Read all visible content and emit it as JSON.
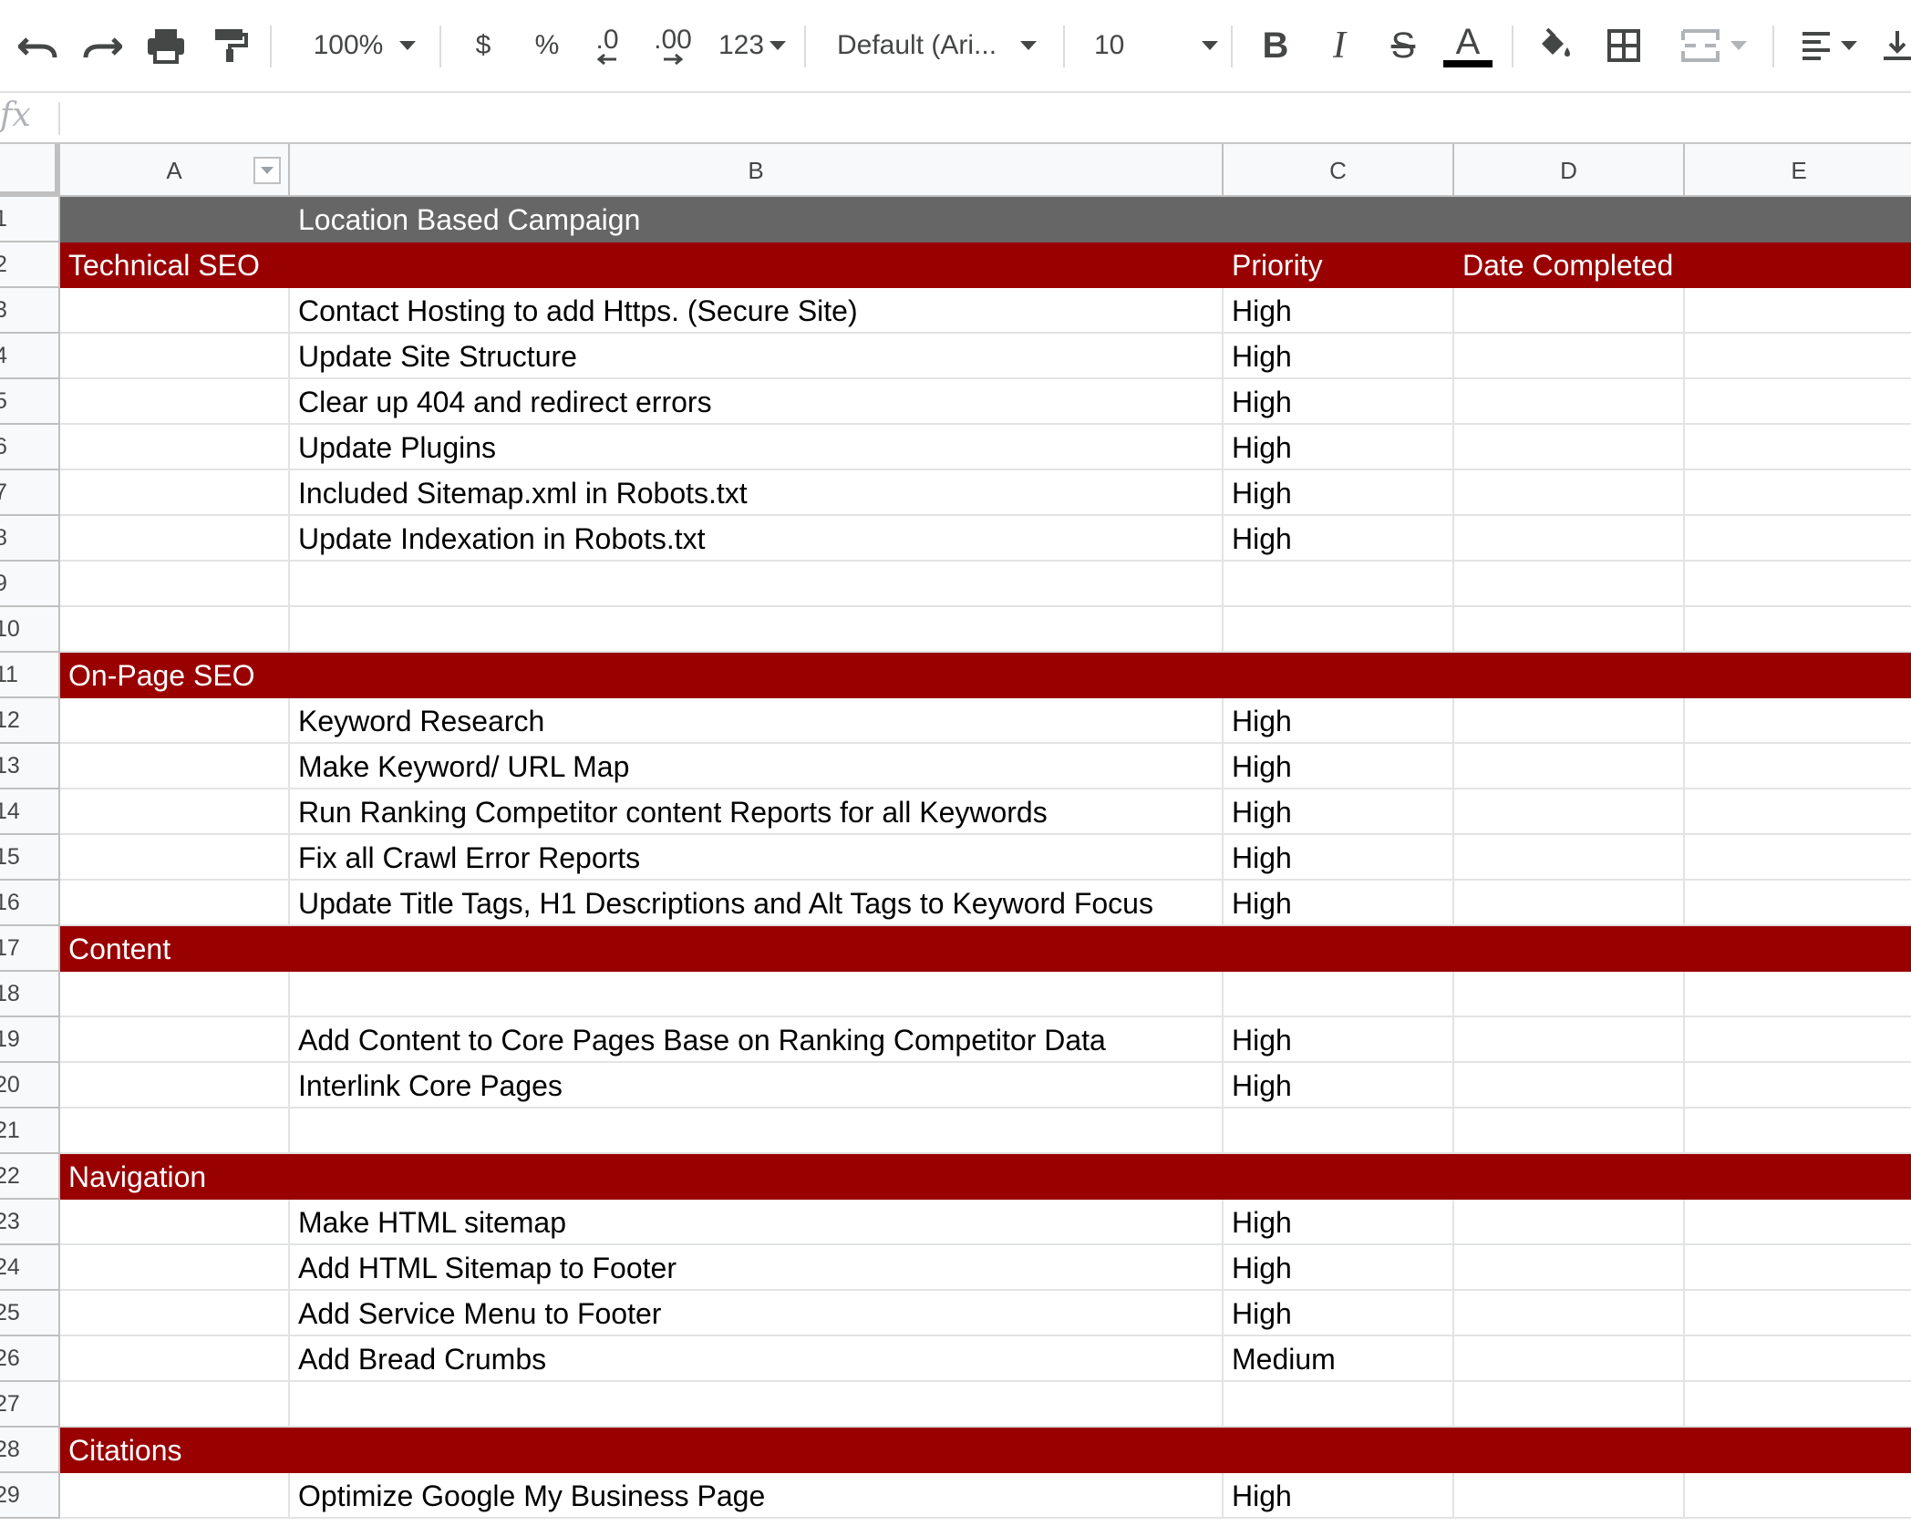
{
  "toolbar": {
    "zoom": "100%",
    "currency": "$",
    "percent": "%",
    "decrease_decimal": ".0",
    "increase_decimal": ".00",
    "more_formats": "123",
    "font": "Default (Ari...",
    "font_size": "10",
    "text_color_accent": "#000000"
  },
  "formula_bar": {
    "fx_label": "fx",
    "value": ""
  },
  "columns": [
    "A",
    "B",
    "C",
    "D",
    "E"
  ],
  "colors": {
    "title_bg": "#666666",
    "section_bg": "#990000",
    "section_text": "#ffffff"
  },
  "rows": [
    {
      "num": "1",
      "type": "title",
      "a": "",
      "b": "Location Based Campaign",
      "c": "",
      "d": ""
    },
    {
      "num": "2",
      "type": "section",
      "a": "Technical SEO",
      "b": "",
      "c": "Priority",
      "d": "Date Completed"
    },
    {
      "num": "3",
      "type": "data",
      "a": "",
      "b": "Contact Hosting to add Https.  (Secure Site)",
      "c": "High",
      "d": ""
    },
    {
      "num": "4",
      "type": "data",
      "a": "",
      "b": "Update Site Structure",
      "c": "High",
      "d": ""
    },
    {
      "num": "5",
      "type": "data",
      "a": "",
      "b": "Clear up 404 and redirect errors",
      "c": "High",
      "d": ""
    },
    {
      "num": "6",
      "type": "data",
      "a": "",
      "b": "Update Plugins",
      "c": "High",
      "d": ""
    },
    {
      "num": "7",
      "type": "data",
      "a": "",
      "b": "Included Sitemap.xml  in Robots.txt",
      "c": "High",
      "d": ""
    },
    {
      "num": "8",
      "type": "data",
      "a": "",
      "b": "Update Indexation in Robots.txt",
      "c": "High",
      "d": ""
    },
    {
      "num": "9",
      "type": "data",
      "a": "",
      "b": "",
      "c": "",
      "d": ""
    },
    {
      "num": "10",
      "type": "data",
      "a": "",
      "b": "",
      "c": "",
      "d": ""
    },
    {
      "num": "11",
      "type": "section",
      "a": "On-Page SEO",
      "b": "",
      "c": "",
      "d": ""
    },
    {
      "num": "12",
      "type": "data",
      "a": "",
      "b": "Keyword Research",
      "c": "High",
      "d": ""
    },
    {
      "num": "13",
      "type": "data",
      "a": "",
      "b": "Make Keyword/ URL Map",
      "c": "High",
      "d": ""
    },
    {
      "num": "14",
      "type": "data",
      "a": "",
      "b": "Run Ranking Competitor content Reports for all Keywords",
      "c": "High",
      "d": ""
    },
    {
      "num": "15",
      "type": "data",
      "a": "",
      "b": "Fix all Crawl Error Reports",
      "c": "High",
      "d": ""
    },
    {
      "num": "16",
      "type": "data",
      "a": "",
      "b": "Update Title Tags, H1  Descriptions and Alt Tags to Keyword Focus",
      "c": "High",
      "d": ""
    },
    {
      "num": "17",
      "type": "section",
      "a": "Content",
      "b": "",
      "c": "",
      "d": ""
    },
    {
      "num": "18",
      "type": "data",
      "a": "",
      "b": "",
      "c": "",
      "d": ""
    },
    {
      "num": "19",
      "type": "data",
      "a": "",
      "b": "Add Content to Core Pages Base on Ranking Competitor Data",
      "c": "High",
      "d": ""
    },
    {
      "num": "20",
      "type": "data",
      "a": "",
      "b": "Interlink Core Pages",
      "c": "High",
      "d": ""
    },
    {
      "num": "21",
      "type": "data",
      "a": "",
      "b": "",
      "c": "",
      "d": ""
    },
    {
      "num": "22",
      "type": "section",
      "a": "Navigation",
      "b": "",
      "c": "",
      "d": ""
    },
    {
      "num": "23",
      "type": "data",
      "a": "",
      "b": "Make HTML sitemap",
      "c": "High",
      "d": ""
    },
    {
      "num": "24",
      "type": "data",
      "a": "",
      "b": "Add HTML  Sitemap to Footer",
      "c": "High",
      "d": ""
    },
    {
      "num": "25",
      "type": "data",
      "a": "",
      "b": "Add Service Menu to Footer",
      "c": "High",
      "d": ""
    },
    {
      "num": "26",
      "type": "data",
      "a": "",
      "b": "Add Bread Crumbs",
      "c": "Medium",
      "d": ""
    },
    {
      "num": "27",
      "type": "data",
      "a": "",
      "b": "",
      "c": "",
      "d": ""
    },
    {
      "num": "28",
      "type": "section",
      "a": "Citations",
      "b": "",
      "c": "",
      "d": ""
    },
    {
      "num": "29",
      "type": "data",
      "a": "",
      "b": "Optimize Google My Business Page",
      "c": "High",
      "d": ""
    }
  ]
}
